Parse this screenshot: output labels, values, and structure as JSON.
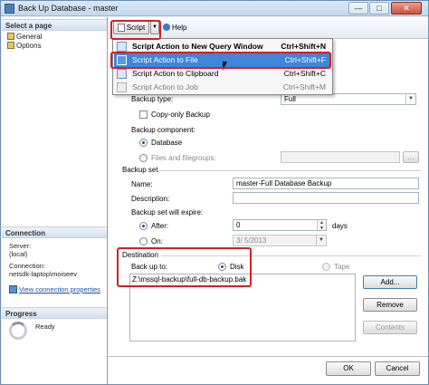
{
  "window": {
    "title": "Back Up Database - master",
    "controls": {
      "minimize": "—",
      "maximize": "□",
      "close": "✕"
    }
  },
  "left_pane": {
    "select_page_header": "Select a page",
    "pages": [
      {
        "label": "General",
        "icon": "page-icon"
      },
      {
        "label": "Options",
        "icon": "page-icon"
      }
    ],
    "connection_header": "Connection",
    "server_label": "Server:",
    "server_value": "(local)",
    "connection_label": "Connection:",
    "connection_value": "netsdk-laptop\\moiseev",
    "view_connection_link": "View connection properties",
    "progress_header": "Progress",
    "progress_status": "Ready"
  },
  "toolbar": {
    "script_label": "Script",
    "help_label": "Help"
  },
  "script_menu": {
    "items": [
      {
        "label": "Script Action to New Query Window",
        "shortcut": "Ctrl+Shift+N",
        "state": "normal"
      },
      {
        "label": "Script Action to File",
        "shortcut": "Ctrl+Shift+F",
        "state": "highlighted"
      },
      {
        "label": "Script Action to Clipboard",
        "shortcut": "Ctrl+Shift+C",
        "state": "normal"
      },
      {
        "label": "Script Action to Job",
        "shortcut": "Ctrl+Shift+M",
        "state": "disabled"
      }
    ]
  },
  "form": {
    "backup_type_label": "Backup type:",
    "backup_type_value": "Full",
    "copy_only_label": "Copy-only Backup",
    "backup_component_label": "Backup component:",
    "database_option": "Database",
    "files_option": "Files and filegroups:",
    "backup_set_header": "Backup set",
    "name_label": "Name:",
    "name_value": "master-Full Database Backup",
    "description_label": "Description:",
    "description_value": "",
    "expire_label": "Backup set will expire:",
    "after_label": "After:",
    "after_value": "0",
    "days_label": "days",
    "on_label": "On:",
    "on_value": "3/  5/2013",
    "destination_header": "Destination",
    "backup_to_label": "Back up to:",
    "disk_option": "Disk",
    "tape_option": "Tape",
    "destination_path": "Z:\\mssql-backup\\full-db-backup.bak"
  },
  "buttons": {
    "add": "Add...",
    "remove": "Remove",
    "contents": "Contents",
    "ok": "OK",
    "cancel": "Cancel"
  },
  "colors": {
    "highlight": "#3f86d8",
    "annotation_red": "#d21f2a",
    "link": "#1c4fb0"
  }
}
